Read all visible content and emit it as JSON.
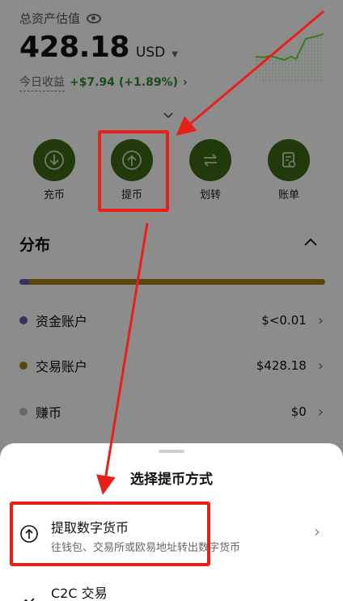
{
  "header": {
    "total_label": "总资产估值",
    "amount": "428.18",
    "currency": "USD",
    "today_label": "今日收益",
    "today_value": "+$7.94 (+1.89%)",
    "today_arrow": "›"
  },
  "actions": [
    {
      "label": "充币",
      "icon": "deposit-icon"
    },
    {
      "label": "提币",
      "icon": "withdraw-icon"
    },
    {
      "label": "划转",
      "icon": "transfer-icon"
    },
    {
      "label": "账单",
      "icon": "bill-icon"
    }
  ],
  "distribution": {
    "title": "分布",
    "accounts": [
      {
        "name": "资金账户",
        "value": "$<0.01",
        "color": "#5b5fb8"
      },
      {
        "name": "交易账户",
        "value": "$428.18",
        "color": "#a68016"
      },
      {
        "name": "赚币",
        "value": "$0",
        "color": "#bdbdbd"
      }
    ]
  },
  "sheet": {
    "title": "选择提币方式",
    "options": [
      {
        "title": "提取数字货币",
        "desc": "往钱包、交易所或欧易地址转出数字货币"
      },
      {
        "title": "C2C 交易"
      }
    ]
  },
  "colors": {
    "accent_green": "#3b6b15",
    "gain_green": "#2f8a2f",
    "annotation_red": "#e8201a"
  }
}
